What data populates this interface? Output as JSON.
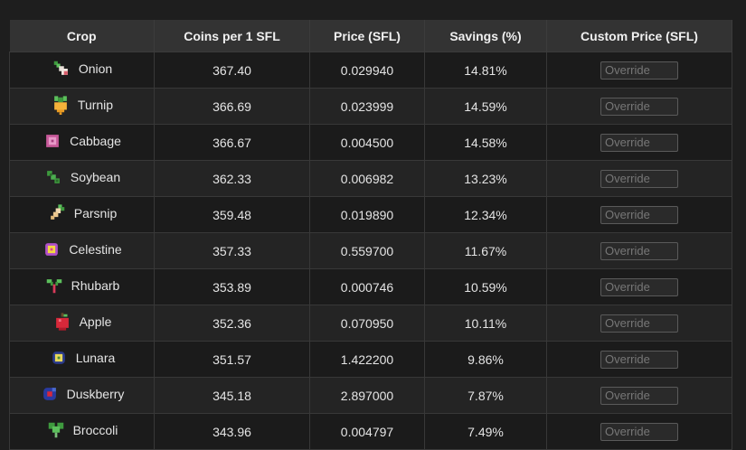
{
  "table": {
    "headers": [
      "Crop",
      "Coins per 1 SFL",
      "Price (SFL)",
      "Savings (%)",
      "Custom Price (SFL)"
    ],
    "override_placeholder": "Override",
    "rows": [
      {
        "crop": "Onion",
        "icon": "onion-icon",
        "coins": "367.40",
        "price": "0.029940",
        "savings": "14.81%"
      },
      {
        "crop": "Turnip",
        "icon": "turnip-icon",
        "coins": "366.69",
        "price": "0.023999",
        "savings": "14.59%"
      },
      {
        "crop": "Cabbage",
        "icon": "cabbage-icon",
        "coins": "366.67",
        "price": "0.004500",
        "savings": "14.58%"
      },
      {
        "crop": "Soybean",
        "icon": "soybean-icon",
        "coins": "362.33",
        "price": "0.006982",
        "savings": "13.23%"
      },
      {
        "crop": "Parsnip",
        "icon": "parsnip-icon",
        "coins": "359.48",
        "price": "0.019890",
        "savings": "12.34%"
      },
      {
        "crop": "Celestine",
        "icon": "celestine-icon",
        "coins": "357.33",
        "price": "0.559700",
        "savings": "11.67%"
      },
      {
        "crop": "Rhubarb",
        "icon": "rhubarb-icon",
        "coins": "353.89",
        "price": "0.000746",
        "savings": "10.59%"
      },
      {
        "crop": "Apple",
        "icon": "apple-icon",
        "coins": "352.36",
        "price": "0.070950",
        "savings": "10.11%"
      },
      {
        "crop": "Lunara",
        "icon": "lunara-icon",
        "coins": "351.57",
        "price": "1.422200",
        "savings": "9.86%"
      },
      {
        "crop": "Duskberry",
        "icon": "duskberry-icon",
        "coins": "345.18",
        "price": "2.897000",
        "savings": "7.87%"
      },
      {
        "crop": "Broccoli",
        "icon": "broccoli-icon",
        "coins": "343.96",
        "price": "0.004797",
        "savings": "7.49%"
      }
    ]
  },
  "colors": {
    "background": "#1e1e1e",
    "header_bg": "#333333",
    "row_odd": "#1b1b1b",
    "row_even": "#242424",
    "border": "#383838"
  }
}
